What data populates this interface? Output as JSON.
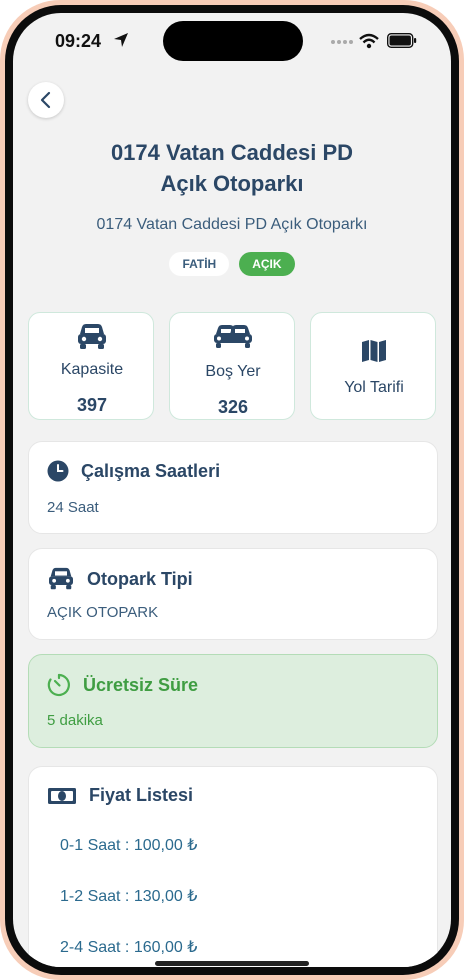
{
  "status_bar": {
    "time": "09:24"
  },
  "header": {
    "title_line1": "0174 Vatan Caddesi PD",
    "title_line2": "Açık Otoparkı",
    "subtitle": "0174 Vatan Caddesi PD Açık Otoparkı",
    "district_badge": "FATİH",
    "status_badge": "AÇIK"
  },
  "stats": {
    "capacity": {
      "label": "Kapasite",
      "value": "397",
      "icon": "car-icon"
    },
    "free": {
      "label": "Boş Yer",
      "value": "326",
      "icon": "cars-icon"
    },
    "directions": {
      "label": "Yol Tarifi",
      "icon": "map-icon"
    }
  },
  "hours": {
    "title": "Çalışma Saatleri",
    "value": "24 Saat",
    "icon": "clock-icon"
  },
  "park_type": {
    "title": "Otopark Tipi",
    "value": "AÇIK OTOPARK",
    "icon": "car-icon"
  },
  "free_time": {
    "title": "Ücretsiz Süre",
    "value": "5 dakika",
    "icon": "timer-icon"
  },
  "prices": {
    "title": "Fiyat Listesi",
    "icon": "money-icon",
    "items": [
      "0-1 Saat : 100,00 ₺",
      "1-2 Saat : 130,00 ₺",
      "2-4 Saat : 160,00 ₺"
    ]
  },
  "colors": {
    "primary": "#2b4766",
    "accent": "#4caf50",
    "free_bg": "#ddeede"
  }
}
